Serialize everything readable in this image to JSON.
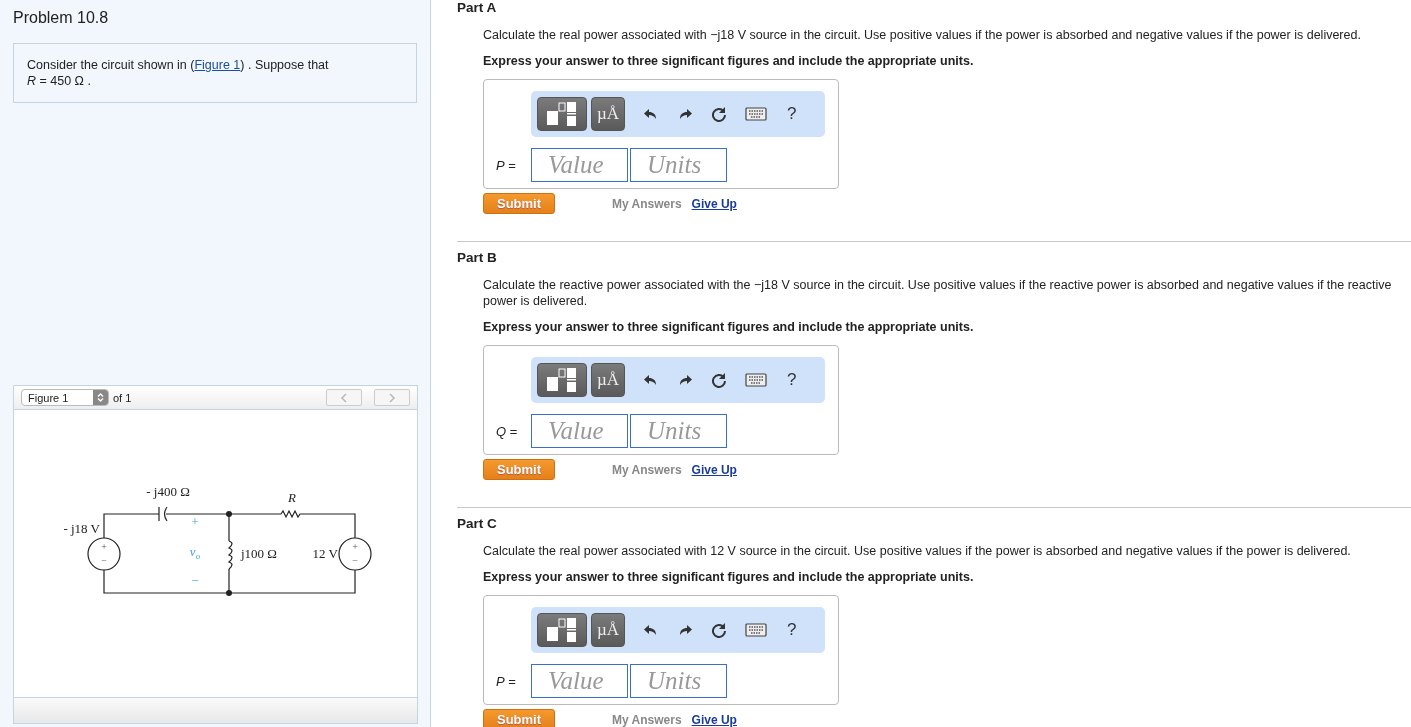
{
  "problem": {
    "title": "Problem 10.8",
    "statement_before": "Consider the circuit shown in (",
    "statement_link": "Figure 1",
    "statement_after": ") . Suppose that",
    "given": "*R* = 450 Ω ."
  },
  "figure": {
    "selector": "Figure 1",
    "count": "of 1",
    "prev_disabled": true,
    "next_disabled": true,
    "circuit": {
      "capacitor": "- j400 Ω",
      "resistor": "*R*",
      "left_source": "- j18 V",
      "inductor": "j100 Ω",
      "right_source": "12 V",
      "output_voltage": "*v*$_{o}$",
      "output_plus": "+",
      "output_minus": "−",
      "left_plus": "+",
      "left_minus": "−",
      "right_plus": "+",
      "right_minus": "−"
    }
  },
  "parts": [
    {
      "title": "Part A",
      "prompt": "Calculate the real power associated with −j18 V source in the circuit. Use positive values if the power is absorbed and negative values if the power is delivered.",
      "instruction": "Express your answer to three significant figures and include the appropriate units.",
      "units_tool": "µÅ",
      "help": "?",
      "variable": "*P* =",
      "value_placeholder": "Value",
      "units_placeholder": "Units",
      "submit": "Submit",
      "my_answers": "My Answers",
      "give_up": "Give Up"
    },
    {
      "title": "Part B",
      "prompt": "Calculate the reactive power associated with the −j18 V source in the circuit. Use positive values if the reactive power is absorbed and negative values if the reactive power is delivered.",
      "instruction": "Express your answer to three significant figures and include the appropriate units.",
      "units_tool": "µÅ",
      "help": "?",
      "variable": "*Q* =",
      "value_placeholder": "Value",
      "units_placeholder": "Units",
      "submit": "Submit",
      "my_answers": "My Answers",
      "give_up": "Give Up"
    },
    {
      "title": "Part C",
      "prompt": "Calculate the real power associated with 12 V source in the circuit. Use positive values if the power is absorbed and negative values if the power is delivered.",
      "instruction": "Express your answer to three significant figures and include the appropriate units.",
      "units_tool": "µÅ",
      "help": "?",
      "variable": "*P* =",
      "value_placeholder": "Value",
      "units_placeholder": "Units",
      "submit": "Submit",
      "my_answers": "My Answers",
      "give_up": "Give Up"
    }
  ]
}
